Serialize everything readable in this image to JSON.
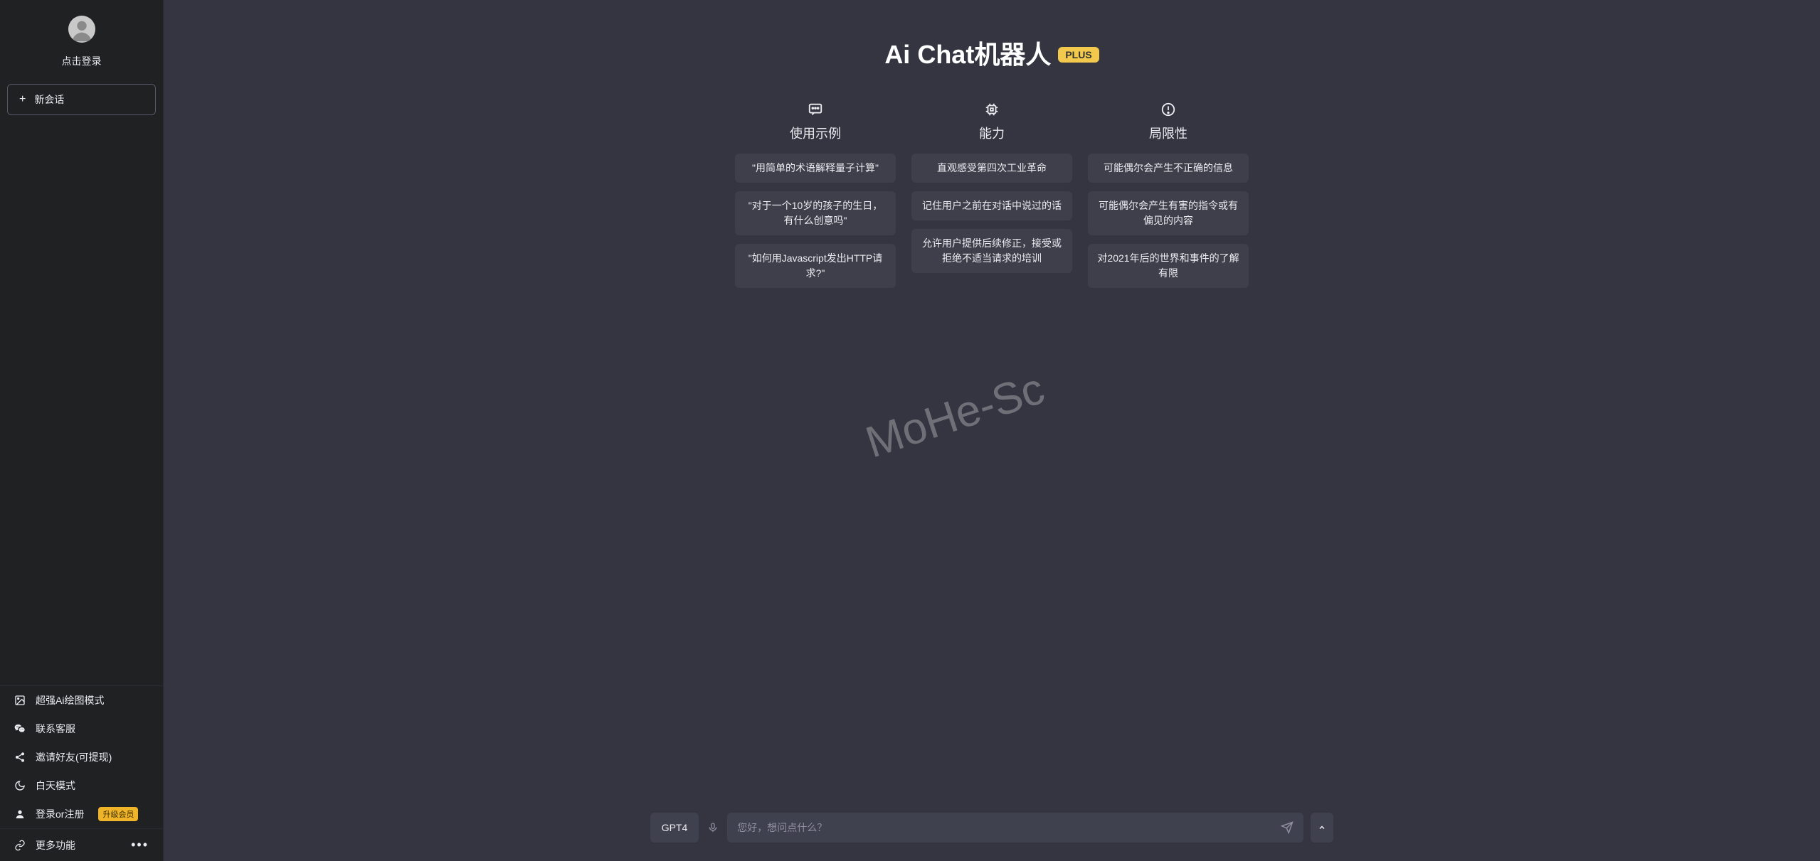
{
  "sidebar": {
    "login_text": "点击登录",
    "new_chat_label": "新会话",
    "menu": [
      {
        "label": "超强Ai绘图模式",
        "icon": "image-icon"
      },
      {
        "label": "联系客服",
        "icon": "wechat-icon"
      },
      {
        "label": "邀请好友(可提现)",
        "icon": "share-icon"
      },
      {
        "label": "白天模式",
        "icon": "moon-icon"
      },
      {
        "label": "登录or注册",
        "icon": "user-icon",
        "badge": "升级会员"
      }
    ],
    "more_label": "更多功能"
  },
  "hero": {
    "title": "Ai Chat机器人",
    "plus_badge": "PLUS",
    "columns": [
      {
        "title": "使用示例",
        "icon": "chat-icon",
        "items": [
          "\"用简单的术语解释量子计算\"",
          "\"对于一个10岁的孩子的生日，有什么创意吗\"",
          "\"如何用Javascript发出HTTP请求?\""
        ],
        "clickable": true
      },
      {
        "title": "能力",
        "icon": "chip-icon",
        "items": [
          "直观感受第四次工业革命",
          "记住用户之前在对话中说过的话",
          "允许用户提供后续修正，接受或拒绝不适当请求的培训"
        ],
        "clickable": false
      },
      {
        "title": "局限性",
        "icon": "warning-icon",
        "items": [
          "可能偶尔会产生不正确的信息",
          "可能偶尔会产生有害的指令或有偏见的内容",
          "对2021年后的世界和事件的了解有限"
        ],
        "clickable": false
      }
    ]
  },
  "watermark": "MoHe-Sc",
  "input": {
    "model_label": "GPT4",
    "placeholder": "您好，想问点什么？"
  }
}
